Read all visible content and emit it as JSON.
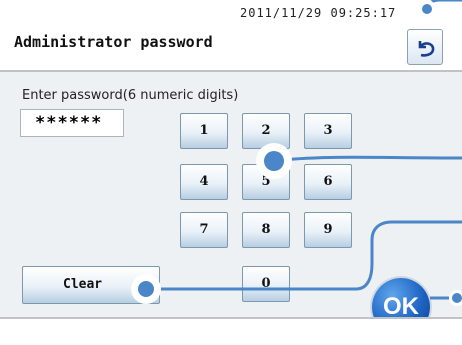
{
  "header": {
    "datetime": "2011/11/29 09:25:17",
    "title": "Administrator password",
    "back_icon": "return-arrow-icon"
  },
  "form": {
    "prompt": "Enter password(6 numeric digits)",
    "password_value": "******"
  },
  "keypad": {
    "keys": [
      "1",
      "2",
      "3",
      "4",
      "5",
      "6",
      "7",
      "8",
      "9",
      "0"
    ]
  },
  "buttons": {
    "clear_label": "Clear",
    "ok_label": "OK"
  },
  "colors": {
    "accent": "#1d63c2",
    "callout": "#4a86c8"
  }
}
